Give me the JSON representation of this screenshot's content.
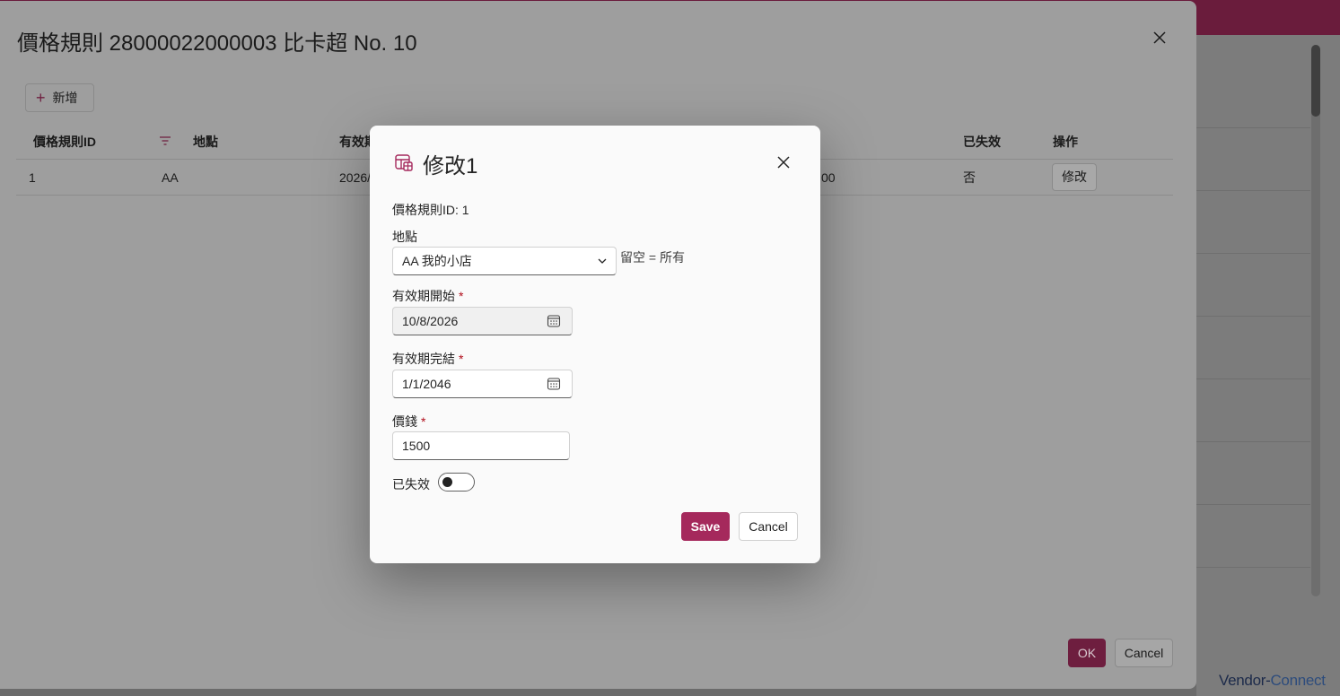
{
  "brand": {
    "part1": "Vendor-",
    "part2": "Connect"
  },
  "outer_dialog": {
    "title": "價格規則 28000022000003 比卡超 No. 10",
    "add_label": "新增",
    "columns": [
      "價格規則ID",
      "地點",
      "有效期",
      "已失效",
      "操作"
    ],
    "rows": [
      {
        "id": "1",
        "location": "AA",
        "start": "2026/",
        "price_tail": "00",
        "expired": "否",
        "action": "修改"
      }
    ],
    "ok_label": "OK",
    "cancel_label": "Cancel"
  },
  "modal": {
    "title": "修改1",
    "rule_id_text": "價格規則ID: 1",
    "location_label": "地點",
    "location_value": "AA 我的小店",
    "location_hint": "留空 = 所有",
    "start_label": "有效期開始",
    "start_value": "10/8/2026",
    "end_label": "有效期完結",
    "end_value": "1/1/2046",
    "price_label": "價錢",
    "price_value": "1500",
    "expired_label": "已失效",
    "expired_on": false,
    "required_mark": "*",
    "save_label": "Save",
    "cancel_label": "Cancel"
  },
  "colors": {
    "accent": "#a5295c",
    "accent_dim": "#6e1e3f",
    "topbar": "#6a1c3c"
  }
}
